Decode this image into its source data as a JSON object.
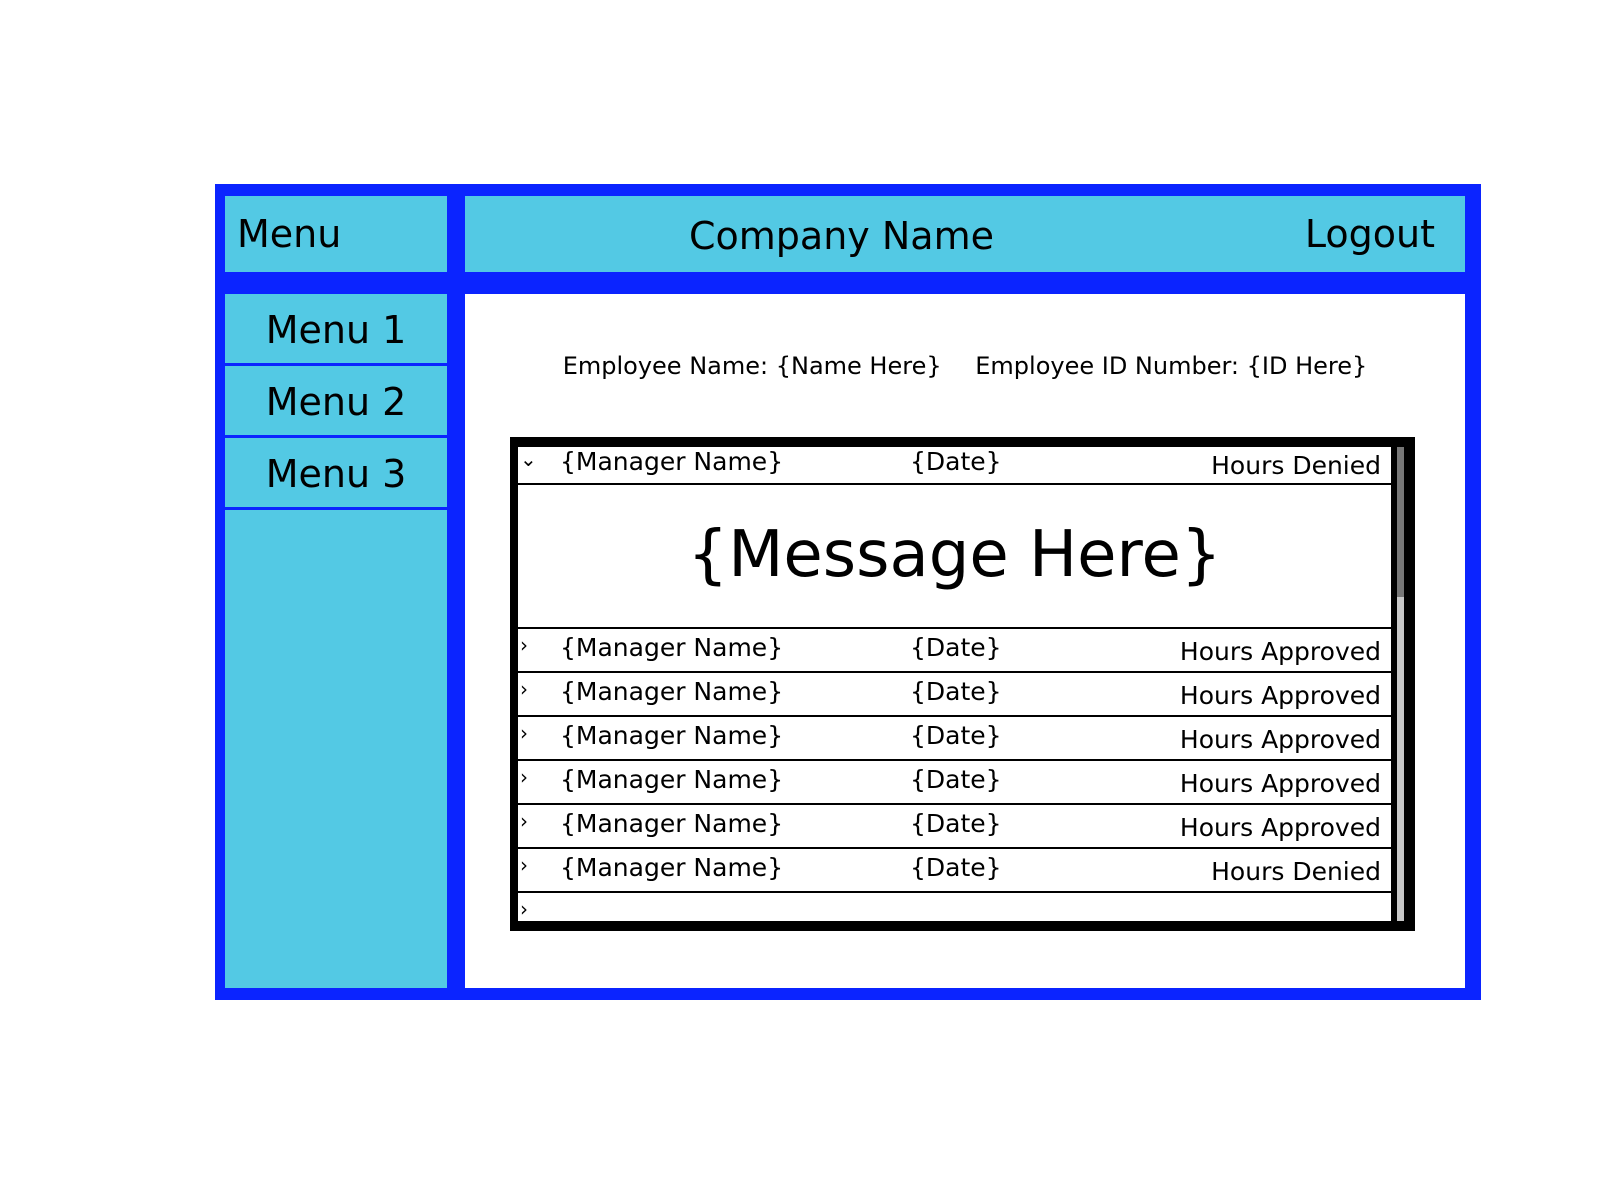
{
  "menu_header": "Menu",
  "sidebar": {
    "items": [
      "Menu 1",
      "Menu 2",
      "Menu 3"
    ]
  },
  "header": {
    "company_name": "Company Name",
    "logout_label": "Logout"
  },
  "employee": {
    "name_label": "Employee Name: {Name Here}",
    "id_label": "Employee ID Number: {ID Here}"
  },
  "requests": {
    "expanded_message": "{Message Here}",
    "rows": [
      {
        "manager": "{Manager Name}",
        "date": "{Date}",
        "status": "Hours Denied",
        "expanded": true
      },
      {
        "manager": "{Manager Name}",
        "date": "{Date}",
        "status": "Hours Approved",
        "expanded": false
      },
      {
        "manager": "{Manager Name}",
        "date": "{Date}",
        "status": "Hours Approved",
        "expanded": false
      },
      {
        "manager": "{Manager Name}",
        "date": "{Date}",
        "status": "Hours Approved",
        "expanded": false
      },
      {
        "manager": "{Manager Name}",
        "date": "{Date}",
        "status": "Hours Approved",
        "expanded": false
      },
      {
        "manager": "{Manager Name}",
        "date": "{Date}",
        "status": "Hours Approved",
        "expanded": false
      },
      {
        "manager": "{Manager Name}",
        "date": "{Date}",
        "status": "Hours Denied",
        "expanded": false
      }
    ]
  },
  "icons": {
    "expanded": "chevron-down-icon",
    "collapsed": "chevron-right-icon"
  },
  "colors": {
    "frame": "#0b24ff",
    "panel": "#53c9e4",
    "content": "#ffffff",
    "list_border": "#000000"
  }
}
